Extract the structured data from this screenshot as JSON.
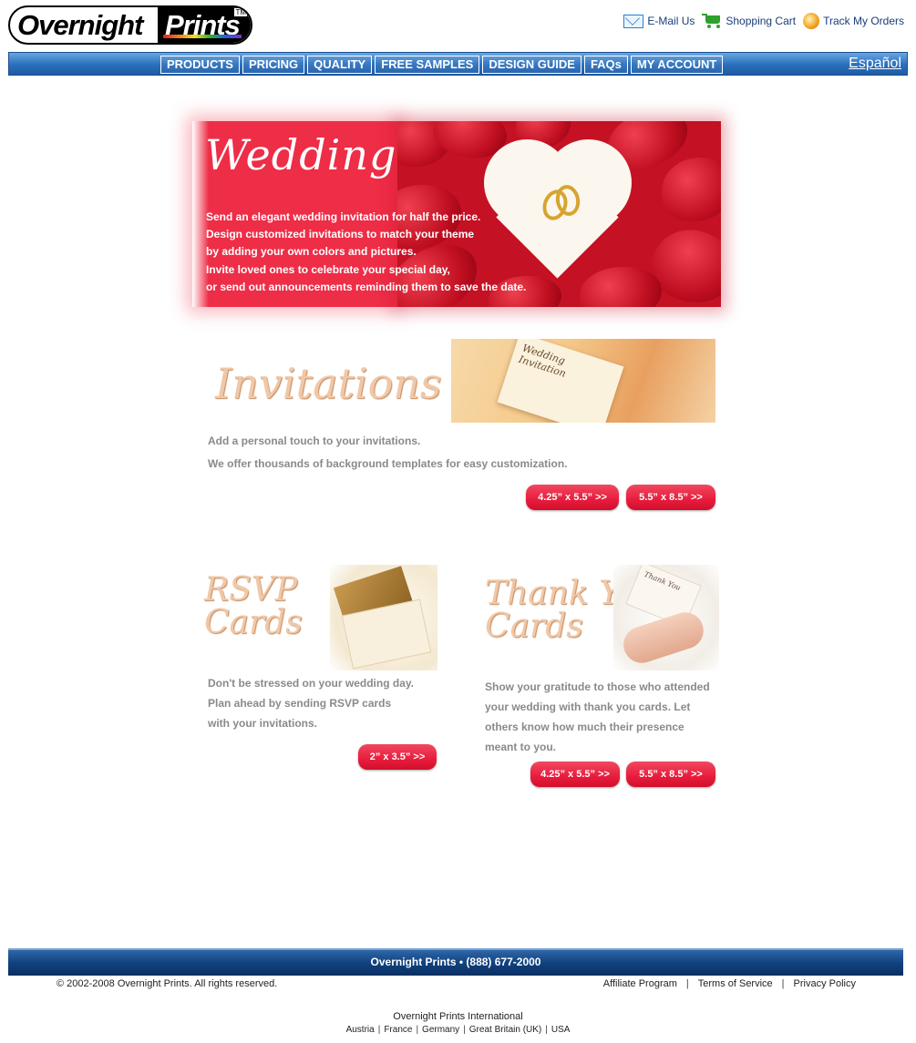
{
  "header": {
    "logo_left": "Overnight",
    "logo_right": "Prints",
    "logo_tm": "TM",
    "links": [
      {
        "label": "E-Mail Us",
        "icon": "mail-icon"
      },
      {
        "label": "Shopping Cart",
        "icon": "cart-icon"
      },
      {
        "label": "Track My Orders",
        "icon": "track-icon"
      }
    ]
  },
  "nav": {
    "items": [
      "PRODUCTS",
      "PRICING",
      "QUALITY",
      "FREE SAMPLES",
      "DESIGN GUIDE",
      "FAQs",
      "MY ACCOUNT"
    ],
    "language": "Español"
  },
  "hero": {
    "title": "Wedding",
    "lines": [
      "Send an elegant wedding invitation for half the price.",
      "Design customized invitations to match your theme",
      "by adding your own colors and pictures.",
      "Invite loved ones to celebrate your special day,",
      "or send out announcements reminding them to save the date."
    ]
  },
  "invitations": {
    "title": "Invitations",
    "image_text": "Wedding Invitation",
    "line1": "Add a personal touch to your invitations.",
    "line2": "We offer thousands of background templates for easy customization.",
    "buttons": [
      "4.25” x 5.5” >>",
      "5.5” x 8.5” >>"
    ]
  },
  "rsvp": {
    "title_line1": "RSVP",
    "title_line2": "Cards",
    "lines": [
      "Don't be stressed on your wedding day.",
      "Plan ahead by sending RSVP cards",
      "with your invitations."
    ],
    "button": "2” x 3.5” >>"
  },
  "thankyou": {
    "title_line1": "Thank You",
    "title_line2": "Cards",
    "image_text": "Thank You",
    "lines": [
      "Show your gratitude to those who attended",
      "your wedding with thank you cards.  Let",
      "others know how much their presence",
      "meant to you."
    ],
    "buttons": [
      "4.25” x 5.5” >>",
      "5.5” x 8.5” >>"
    ]
  },
  "footer": {
    "bar": "Overnight Prints • (888) 677-2000",
    "copyright": "© 2002-2008 Overnight Prints. All rights reserved.",
    "links": [
      "Affiliate Program",
      "Terms of Service",
      "Privacy Policy"
    ],
    "intl_title": "Overnight Prints International",
    "intl_links": [
      "Austria",
      "France",
      "Germany",
      "Great Britain (UK)",
      "USA"
    ]
  },
  "colors": {
    "nav_blue": "#2a6fbd",
    "hero_red": "#ee2d47",
    "button_red": "#e81c3c",
    "footer_navy": "#11427f",
    "body_grey_text": "#8a8a8a"
  }
}
